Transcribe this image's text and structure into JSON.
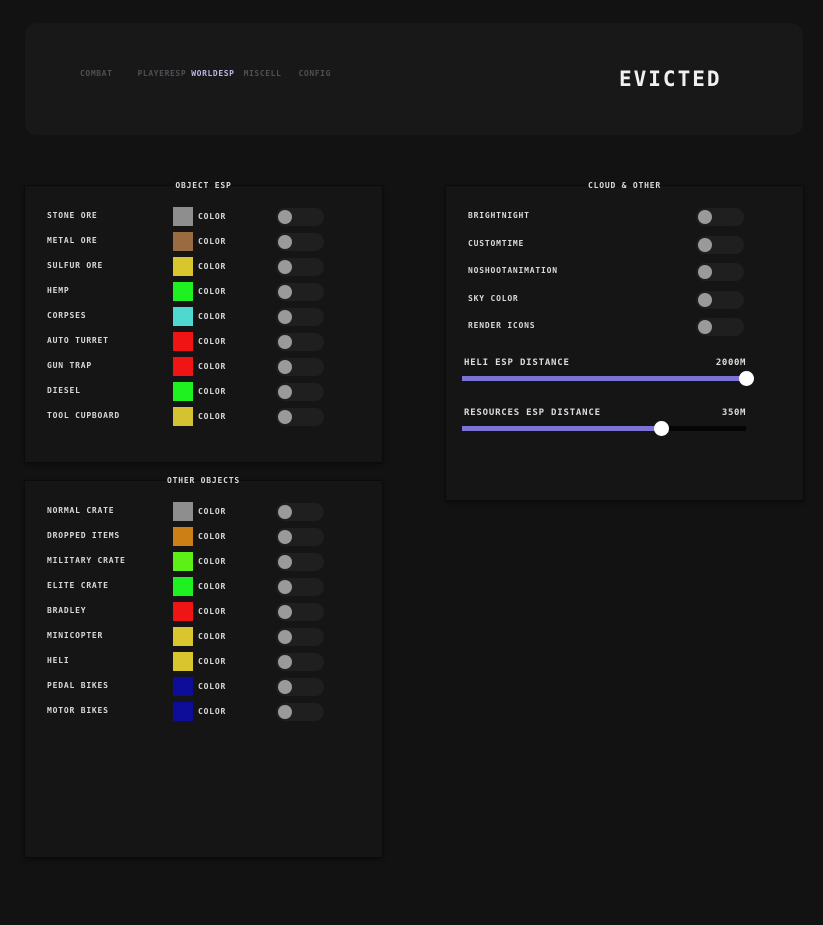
{
  "header": {
    "title": "EVICTED",
    "tabs": [
      {
        "label": "COMBAT",
        "active": false
      },
      {
        "label": "PLAYERESP",
        "active": false
      },
      {
        "label": "WORLDESP",
        "active": true
      },
      {
        "label": "MISCELL",
        "active": false
      },
      {
        "label": "CONFIG",
        "active": false
      }
    ]
  },
  "object_esp": {
    "title": "OBJECT ESP",
    "items": [
      {
        "label": "STONE ORE",
        "color": "#8e8e8e",
        "color_label": "COLOR",
        "enabled": false
      },
      {
        "label": "METAL ORE",
        "color": "#9a6a40",
        "color_label": "COLOR",
        "enabled": false
      },
      {
        "label": "SULFUR ORE",
        "color": "#d9c62e",
        "color_label": "COLOR",
        "enabled": false
      },
      {
        "label": "HEMP",
        "color": "#1ff01f",
        "color_label": "COLOR",
        "enabled": false
      },
      {
        "label": "CORPSES",
        "color": "#4fd8d0",
        "color_label": "COLOR",
        "enabled": false
      },
      {
        "label": "AUTO TURRET",
        "color": "#f01414",
        "color_label": "COLOR",
        "enabled": false
      },
      {
        "label": "GUN TRAP",
        "color": "#f01414",
        "color_label": "COLOR",
        "enabled": false
      },
      {
        "label": "DIESEL",
        "color": "#1ff01f",
        "color_label": "COLOR",
        "enabled": false
      },
      {
        "label": "TOOL CUPBOARD",
        "color": "#d4c232",
        "color_label": "COLOR",
        "enabled": false
      }
    ]
  },
  "other_objects": {
    "title": "OTHER OBJECTS",
    "items": [
      {
        "label": "NORMAL CRATE",
        "color": "#8e8e8e",
        "color_label": "COLOR",
        "enabled": false
      },
      {
        "label": "DROPPED ITEMS",
        "color": "#cc7f14",
        "color_label": "COLOR",
        "enabled": false
      },
      {
        "label": "MILITARY CRATE",
        "color": "#5cf016",
        "color_label": "COLOR",
        "enabled": false
      },
      {
        "label": "ELITE CRATE",
        "color": "#1ff01f",
        "color_label": "COLOR",
        "enabled": false
      },
      {
        "label": "BRADLEY",
        "color": "#f01414",
        "color_label": "COLOR",
        "enabled": false
      },
      {
        "label": "MINICOPTER",
        "color": "#d9c62e",
        "color_label": "COLOR",
        "enabled": false
      },
      {
        "label": "HELI",
        "color": "#d9c62e",
        "color_label": "COLOR",
        "enabled": false
      },
      {
        "label": "PEDAL BIKES",
        "color": "#0d0d9a",
        "color_label": "COLOR",
        "enabled": false
      },
      {
        "label": "MOTOR BIKES",
        "color": "#0d0d9a",
        "color_label": "COLOR",
        "enabled": false
      }
    ]
  },
  "cloud_other": {
    "title": "CLOUD & OTHER",
    "toggles": [
      {
        "label": "BRIGHTNIGHT",
        "enabled": false
      },
      {
        "label": "CUSTOMTIME",
        "enabled": false
      },
      {
        "label": "NOSHOOTANIMATION",
        "enabled": false
      },
      {
        "label": "SKY COLOR",
        "enabled": false
      },
      {
        "label": "RENDER ICONS",
        "enabled": false
      }
    ],
    "sliders": [
      {
        "label": "HELI ESP DISTANCE",
        "value_text": "2000M",
        "fraction": 1.0
      },
      {
        "label": "RESOURCES ESP DISTANCE",
        "value_text": "350M",
        "fraction": 0.7
      }
    ]
  },
  "colors": {
    "accent": "#7b73d6",
    "active_tab": "#b9b6e6",
    "inactive_tab": "#4f4f55"
  }
}
